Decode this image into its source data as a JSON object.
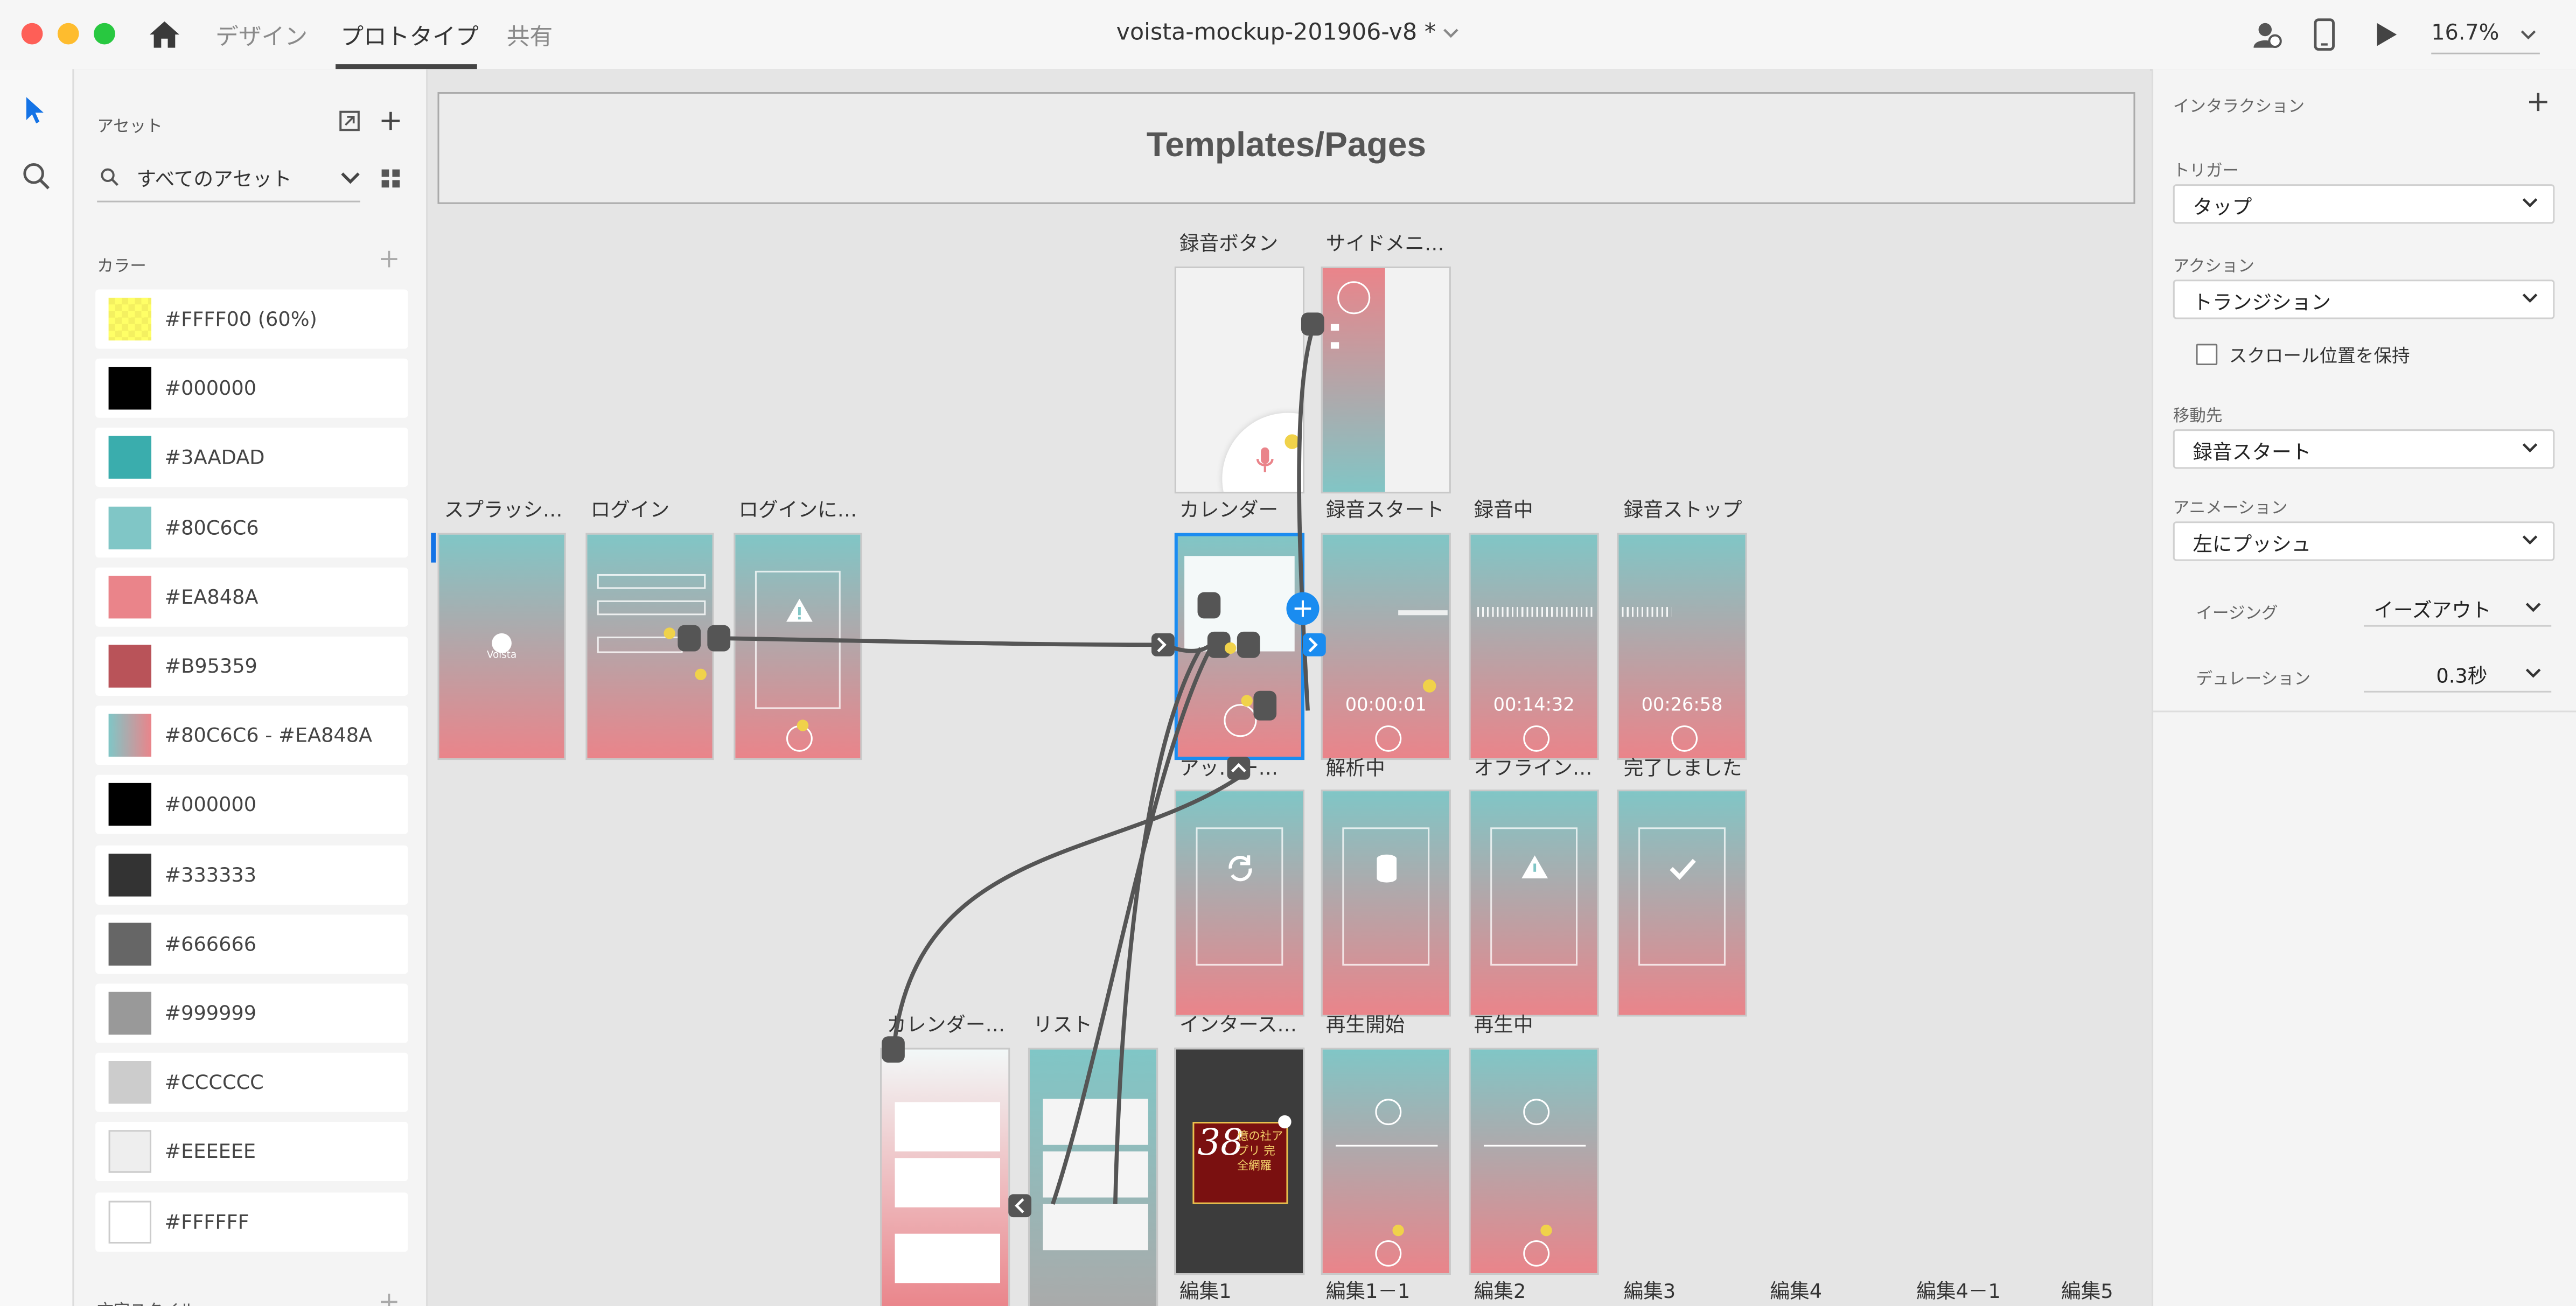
{
  "titlebar": {
    "tabs": [
      "デザイン",
      "プロトタイプ",
      "共有"
    ],
    "document_title": "voista-mockup-201906-v8 *",
    "zoom": "16.7%"
  },
  "assets": {
    "header": "アセット",
    "filter": "すべてのアセット",
    "colors_header": "カラー",
    "colors": [
      {
        "label": "#FFFF00 (60%)",
        "fill": "#FFFF00"
      },
      {
        "label": "#000000",
        "fill": "#000000"
      },
      {
        "label": "#3AADAD",
        "fill": "#3AADAD"
      },
      {
        "label": "#80C6C6",
        "fill": "#80C6C6"
      },
      {
        "label": "#EA848A",
        "fill": "#EA848A"
      },
      {
        "label": "#B95359",
        "fill": "#B95359"
      },
      {
        "label": "#80C6C6 - #EA848A",
        "fill": "gradient"
      },
      {
        "label": "#000000",
        "fill": "#000000"
      },
      {
        "label": "#333333",
        "fill": "#333333"
      },
      {
        "label": "#666666",
        "fill": "#666666"
      },
      {
        "label": "#999999",
        "fill": "#999999"
      },
      {
        "label": "#CCCCCC",
        "fill": "#CCCCCC"
      },
      {
        "label": "#EEEEEE",
        "fill": "#EEEEEE"
      },
      {
        "label": "#FFFFFF",
        "fill": "#FFFFFF"
      }
    ],
    "char_styles_header": "文字スタイル"
  },
  "canvas": {
    "templates_title": "Templates/Pages",
    "artboards": {
      "rec_button": "録音ボタン",
      "side_menu": "サイドメニ…",
      "splash": "スプラッシ…",
      "login": "ログイン",
      "login_err": "ログインに…",
      "calendar": "カレンダー",
      "rec_start": "録音スタート",
      "recording": "録音中",
      "rec_stop": "録音ストップ",
      "upload": "アッ…ー…",
      "analyzing": "解析中",
      "offline": "オフライン…",
      "done": "完了しました",
      "calendar2": "カレンダー…",
      "list": "リスト",
      "interstitial": "インタース…",
      "play_start": "再生開始",
      "playing": "再生中",
      "edit1": "編集1",
      "edit1_1": "編集1－1",
      "edit2": "編集2",
      "edit3": "編集3",
      "edit4": "編集4",
      "edit4_1": "編集4－1",
      "edit5": "編集5"
    },
    "timers": {
      "rec_start": "00:00:01",
      "recording": "00:14:32",
      "rec_stop": "00:26:58"
    },
    "splash_brand": "Voista",
    "ad": {
      "number": "38",
      "text": "億の社アプリ 完全網羅"
    }
  },
  "interaction": {
    "header": "インタラクション",
    "trigger_label": "トリガー",
    "trigger_value": "タップ",
    "action_label": "アクション",
    "action_value": "トランジション",
    "keep_scroll_label": "スクロール位置を保持",
    "destination_label": "移動先",
    "destination_value": "録音スタート",
    "animation_label": "アニメーション",
    "animation_value": "左にプッシュ",
    "easing_label": "イージング",
    "easing_value": "イーズアウト",
    "duration_label": "デュレーション",
    "duration_value": "0.3秒"
  }
}
